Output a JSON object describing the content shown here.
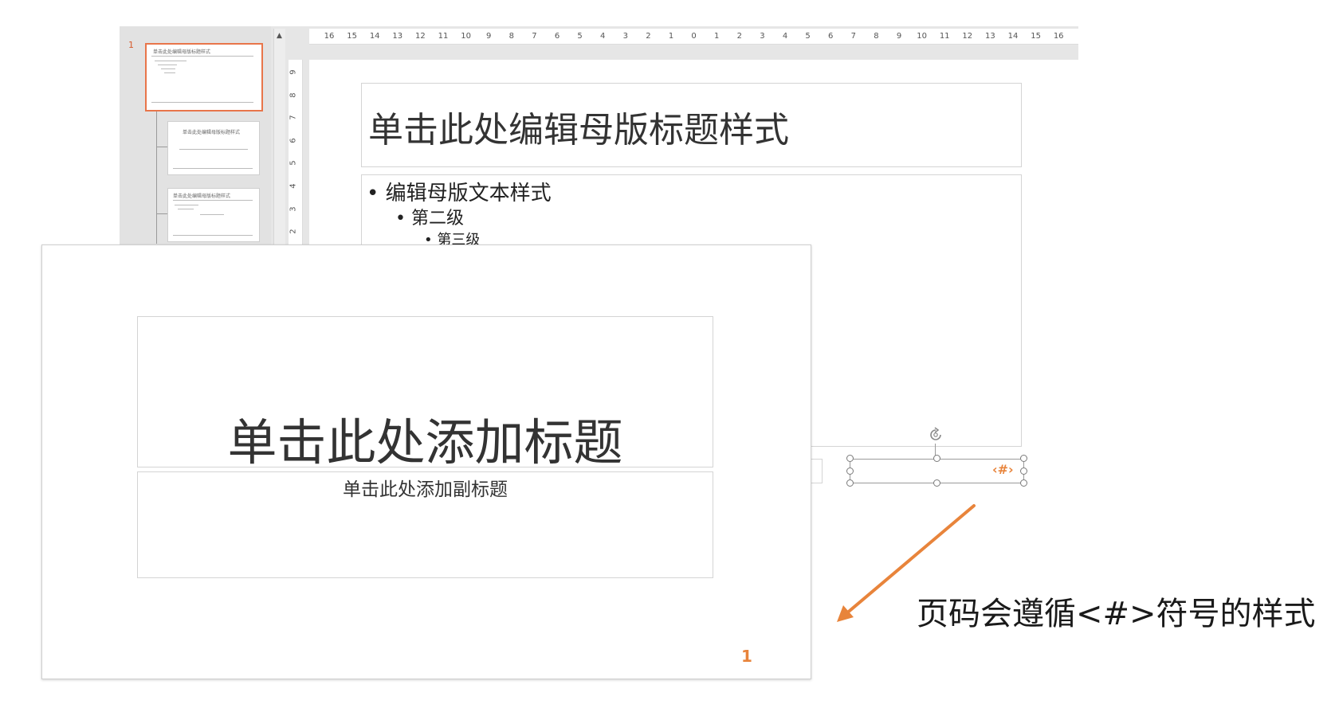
{
  "thumbnail_panel": {
    "slide_number": "1",
    "thumbnails": [
      {
        "title": "单击此处编辑母版标题样式"
      },
      {
        "title": "单击此处编辑母版标题样式"
      },
      {
        "title": "单击此处编辑母版标题样式"
      }
    ],
    "scroll_up_glyph": "▲"
  },
  "ruler": {
    "horizontal_ticks": [
      "16",
      "15",
      "14",
      "13",
      "12",
      "11",
      "10",
      "9",
      "8",
      "7",
      "6",
      "5",
      "4",
      "3",
      "2",
      "1",
      "0",
      "1",
      "2",
      "3",
      "4",
      "5",
      "6",
      "7",
      "8",
      "9",
      "10",
      "11",
      "12",
      "13",
      "14",
      "15",
      "16"
    ],
    "vertical_ticks": [
      "9",
      "8",
      "7",
      "6",
      "5",
      "4",
      "3",
      "2"
    ]
  },
  "master_slide": {
    "title": "单击此处编辑母版标题样式",
    "bullets": [
      {
        "text": "• 编辑母版文本样式"
      },
      {
        "text": "• 第二级"
      },
      {
        "text": "• 第三级"
      }
    ],
    "page_number_placeholder": "‹#›",
    "rotate_icon": "rotate-handle-icon"
  },
  "front_slide": {
    "title": "单击此处添加标题",
    "subtitle": "单击此处添加副标题",
    "page_number": "1"
  },
  "annotation": {
    "text": "页码会遵循<#>符号的样式",
    "arrow_color": "#e8843b"
  },
  "colors": {
    "accent_orange": "#e8843b",
    "thumb_selected_border": "#e8754a"
  }
}
